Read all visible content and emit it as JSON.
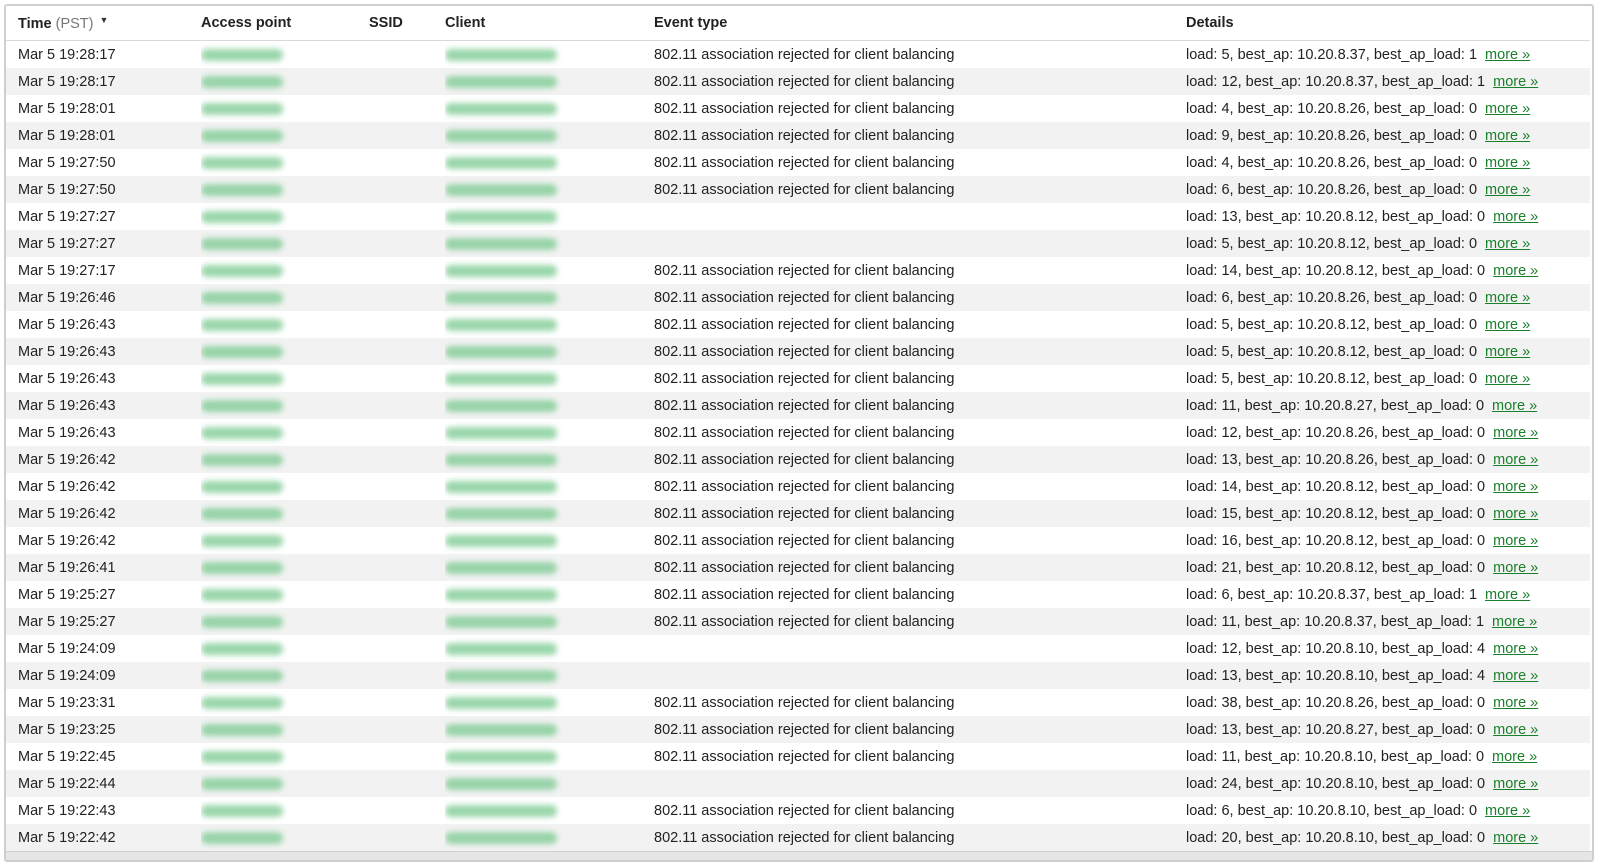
{
  "headers": {
    "time": "Time",
    "time_zone": "(PST)",
    "sort_icon": "▼",
    "access_point": "Access point",
    "ssid": "SSID",
    "client": "Client",
    "event_type": "Event type",
    "details": "Details"
  },
  "more_label": "more »",
  "rows": [
    {
      "time": "Mar 5 19:28:17",
      "event": "802.11 association rejected for client balancing",
      "details": "load: 5, best_ap: 10.20.8.37, best_ap_load: 1"
    },
    {
      "time": "Mar 5 19:28:17",
      "event": "802.11 association rejected for client balancing",
      "details": "load: 12, best_ap: 10.20.8.37, best_ap_load: 1"
    },
    {
      "time": "Mar 5 19:28:01",
      "event": "802.11 association rejected for client balancing",
      "details": "load: 4, best_ap: 10.20.8.26, best_ap_load: 0"
    },
    {
      "time": "Mar 5 19:28:01",
      "event": "802.11 association rejected for client balancing",
      "details": "load: 9, best_ap: 10.20.8.26, best_ap_load: 0"
    },
    {
      "time": "Mar 5 19:27:50",
      "event": "802.11 association rejected for client balancing",
      "details": "load: 4, best_ap: 10.20.8.26, best_ap_load: 0"
    },
    {
      "time": "Mar 5 19:27:50",
      "event": "802.11 association rejected for client balancing",
      "details": "load: 6, best_ap: 10.20.8.26, best_ap_load: 0"
    },
    {
      "time": "Mar 5 19:27:27",
      "event": "",
      "details": "load: 13, best_ap: 10.20.8.12, best_ap_load: 0"
    },
    {
      "time": "Mar 5 19:27:27",
      "event": "",
      "details": "load: 5, best_ap: 10.20.8.12, best_ap_load: 0"
    },
    {
      "time": "Mar 5 19:27:17",
      "event": "802.11 association rejected for client balancing",
      "details": "load: 14, best_ap: 10.20.8.12, best_ap_load: 0"
    },
    {
      "time": "Mar 5 19:26:46",
      "event": "802.11 association rejected for client balancing",
      "details": "load: 6, best_ap: 10.20.8.26, best_ap_load: 0"
    },
    {
      "time": "Mar 5 19:26:43",
      "event": "802.11 association rejected for client balancing",
      "details": "load: 5, best_ap: 10.20.8.12, best_ap_load: 0"
    },
    {
      "time": "Mar 5 19:26:43",
      "event": "802.11 association rejected for client balancing",
      "details": "load: 5, best_ap: 10.20.8.12, best_ap_load: 0"
    },
    {
      "time": "Mar 5 19:26:43",
      "event": "802.11 association rejected for client balancing",
      "details": "load: 5, best_ap: 10.20.8.12, best_ap_load: 0"
    },
    {
      "time": "Mar 5 19:26:43",
      "event": "802.11 association rejected for client balancing",
      "details": "load: 11, best_ap: 10.20.8.27, best_ap_load: 0"
    },
    {
      "time": "Mar 5 19:26:43",
      "event": "802.11 association rejected for client balancing",
      "details": "load: 12, best_ap: 10.20.8.26, best_ap_load: 0"
    },
    {
      "time": "Mar 5 19:26:42",
      "event": "802.11 association rejected for client balancing",
      "details": "load: 13, best_ap: 10.20.8.26, best_ap_load: 0"
    },
    {
      "time": "Mar 5 19:26:42",
      "event": "802.11 association rejected for client balancing",
      "details": "load: 14, best_ap: 10.20.8.12, best_ap_load: 0"
    },
    {
      "time": "Mar 5 19:26:42",
      "event": "802.11 association rejected for client balancing",
      "details": "load: 15, best_ap: 10.20.8.12, best_ap_load: 0"
    },
    {
      "time": "Mar 5 19:26:42",
      "event": "802.11 association rejected for client balancing",
      "details": "load: 16, best_ap: 10.20.8.12, best_ap_load: 0"
    },
    {
      "time": "Mar 5 19:26:41",
      "event": "802.11 association rejected for client balancing",
      "details": "load: 21, best_ap: 10.20.8.12, best_ap_load: 0"
    },
    {
      "time": "Mar 5 19:25:27",
      "event": "802.11 association rejected for client balancing",
      "details": "load: 6, best_ap: 10.20.8.37, best_ap_load: 1"
    },
    {
      "time": "Mar 5 19:25:27",
      "event": "802.11 association rejected for client balancing",
      "details": "load: 11, best_ap: 10.20.8.37, best_ap_load: 1"
    },
    {
      "time": "Mar 5 19:24:09",
      "event": "",
      "details": "load: 12, best_ap: 10.20.8.10, best_ap_load: 4"
    },
    {
      "time": "Mar 5 19:24:09",
      "event": "",
      "details": "load: 13, best_ap: 10.20.8.10, best_ap_load: 4"
    },
    {
      "time": "Mar 5 19:23:31",
      "event": "802.11 association rejected for client balancing",
      "details": "load: 38, best_ap: 10.20.8.26, best_ap_load: 0"
    },
    {
      "time": "Mar 5 19:23:25",
      "event": "802.11 association rejected for client balancing",
      "details": "load: 13, best_ap: 10.20.8.27, best_ap_load: 0"
    },
    {
      "time": "Mar 5 19:22:45",
      "event": "802.11 association rejected for client balancing",
      "details": "load: 11, best_ap: 10.20.8.10, best_ap_load: 0"
    },
    {
      "time": "Mar 5 19:22:44",
      "event": "",
      "details": "load: 24, best_ap: 10.20.8.10, best_ap_load: 0"
    },
    {
      "time": "Mar 5 19:22:43",
      "event": "802.11 association rejected for client balancing",
      "details": "load: 6, best_ap: 10.20.8.10, best_ap_load: 0"
    },
    {
      "time": "Mar 5 19:22:42",
      "event": "802.11 association rejected for client balancing",
      "details": "load: 20, best_ap: 10.20.8.10, best_ap_load: 0"
    }
  ]
}
